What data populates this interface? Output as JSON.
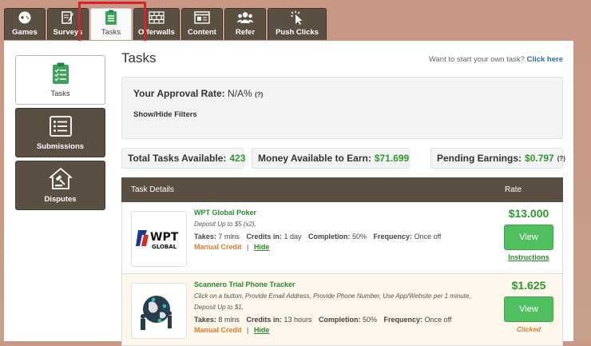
{
  "tabs": [
    {
      "label": "Games",
      "icon": "gamepad-icon"
    },
    {
      "label": "Surveys",
      "icon": "pencil-paper-icon"
    },
    {
      "label": "Tasks",
      "icon": "clipboard-icon",
      "active": true
    },
    {
      "label": "Offerwalls",
      "icon": "brick-wall-icon"
    },
    {
      "label": "Content",
      "icon": "window-icon"
    },
    {
      "label": "Refer",
      "icon": "people-icon"
    },
    {
      "label": "Push Clicks",
      "icon": "cursor-click-icon"
    }
  ],
  "sidebar": {
    "items": [
      {
        "label": "Tasks",
        "icon": "clipboard-icon",
        "active": true
      },
      {
        "label": "Submissions",
        "icon": "list-icon"
      },
      {
        "label": "Disputes",
        "icon": "gavel-icon"
      }
    ]
  },
  "page": {
    "title": "Tasks",
    "own_task_text": "Want to start your own task?",
    "own_task_link": "Click here"
  },
  "approval": {
    "label": "Your Approval Rate:",
    "value": "N/A%",
    "help": "(?)",
    "filters_label": "Show/Hide Filters"
  },
  "stats": {
    "total_label": "Total Tasks Available:",
    "total_value": "423",
    "money_label": "Money Available to Earn:",
    "money_value": "$71.699",
    "pending_label": "Pending Earnings:",
    "pending_value": "$0.797",
    "pending_help": "(?)"
  },
  "table": {
    "headers": {
      "details": "Task Details",
      "rate": "Rate"
    },
    "rows": [
      {
        "name": "WPT Global Poker",
        "description": "Deposit Up to $5 (x2),",
        "takes_label": "Takes:",
        "takes": "7 mins",
        "credits_label": "Credits in:",
        "credits": "1 day",
        "completion_label": "Completion:",
        "completion": "50%",
        "frequency_label": "Frequency:",
        "frequency": "Once off",
        "credit_type": "Manual Credit",
        "separator": "|",
        "hide": "Hide",
        "price": "$13.000",
        "view": "View",
        "status": "Instructions",
        "logo_top": "WPT",
        "logo_sub": "GLOBAL"
      },
      {
        "name": "Scannero Trial Phone Tracker",
        "description": "Click on a button, Provide Email Address, Provide Phone Number, Use App/Website per 1 minute, Deposit Up to $1,",
        "takes_label": "Takes:",
        "takes": "8 mins",
        "credits_label": "Credits in:",
        "credits": "13 hours",
        "completion_label": "Completion:",
        "completion": "50%",
        "frequency_label": "Frequency:",
        "frequency": "Once off",
        "credit_type": "Manual Credit",
        "separator": "|",
        "hide": "Hide",
        "price": "$1.625",
        "view": "View",
        "status": "Clicked"
      }
    ]
  },
  "colors": {
    "tab_bg": "#5b4f42",
    "green": "#2d9a2d",
    "button_green": "#4fbf5f",
    "orange": "#e07b2e",
    "highlight_red": "#d6232e",
    "background": "#c89884"
  }
}
